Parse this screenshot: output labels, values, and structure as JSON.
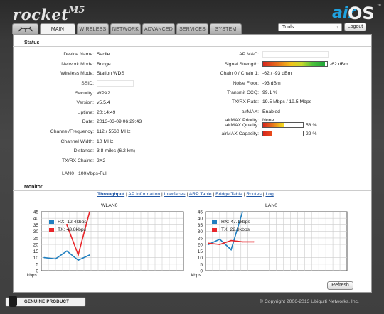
{
  "header": {
    "product": "rocket",
    "model": "M5",
    "brand_air": "air",
    "brand_os": "OS",
    "brand_tm": "™"
  },
  "tabs": [
    {
      "label": "",
      "icon": "ubiquiti-logo-icon"
    },
    {
      "label": "MAIN"
    },
    {
      "label": "WIRELESS"
    },
    {
      "label": "NETWORK"
    },
    {
      "label": "ADVANCED"
    },
    {
      "label": "SERVICES"
    },
    {
      "label": "SYSTEM"
    }
  ],
  "toolbar": {
    "tools_value": "Tools:",
    "tools_arrow": "↕",
    "logout_label": "Logout"
  },
  "status": {
    "title": "Status",
    "left": [
      {
        "k": "Device Name:",
        "v": "Sacile"
      },
      {
        "k": "Network Mode:",
        "v": "Bridge"
      },
      {
        "k": "Wireless Mode:",
        "v": "Station WDS"
      },
      {
        "k": "SSID:",
        "v": ""
      },
      {
        "k": "Security:",
        "v": "WPA2"
      },
      {
        "k": "Version:",
        "v": "v5.5.4"
      },
      {
        "k": "Uptime:",
        "v": "20:14:49"
      },
      {
        "k": "Date:",
        "v": "2013-03-09 06:29:43"
      },
      {
        "k": "Channel/Frequency:",
        "v": "112 / 5560 MHz"
      },
      {
        "k": "Channel Width:",
        "v": "10 MHz"
      },
      {
        "k": "Distance:",
        "v": "3.8 miles (6.2 km)"
      },
      {
        "k": "TX/RX Chains:",
        "v": "2X2"
      }
    ],
    "right": [
      {
        "k": "AP MAC:",
        "v": ""
      },
      {
        "k": "Signal Strength:",
        "v": "-62 dBm"
      },
      {
        "k": "Chain 0 / Chain 1:",
        "v": "-62 / -93 dBm"
      },
      {
        "k": "Noise Floor:",
        "v": "-93 dBm"
      },
      {
        "k": "Transmit CCQ:",
        "v": "99.1 %"
      },
      {
        "k": "TX/RX Rate:",
        "v": "19.5 Mbps / 19.5 Mbps"
      },
      {
        "k": "airMAX:",
        "v": "Enabled"
      },
      {
        "k": "airMAX Priority:",
        "v": "None"
      },
      {
        "k": "airMAX Quality:",
        "v": "53 %"
      },
      {
        "k": "airMAX Capacity:",
        "v": "22 %"
      }
    ],
    "signal_level": 0.97,
    "quality_level": 0.53,
    "capacity_level": 0.22,
    "lan0_label": "LAN0",
    "lan0_value": "100Mbps-Full"
  },
  "monitor": {
    "title": "Monitor",
    "links": [
      "Throughput",
      "AP Information",
      "Interfaces",
      "ARP Table",
      "Bridge Table",
      "Routes",
      "Log"
    ],
    "refresh_label": "Refresh"
  },
  "colors": {
    "rx": "#1f7fc0",
    "tx": "#e8262b",
    "grid": "#cccccc"
  },
  "chart_data": [
    {
      "type": "line",
      "title": "WLAN0",
      "ylabel": "kbps",
      "yticks": [
        "0",
        "5",
        "10",
        "15",
        "20",
        "25",
        "30",
        "35",
        "40",
        "45"
      ],
      "ylim": [
        0,
        45
      ],
      "series": [
        {
          "name": "RX: 12.4kbps",
          "values": [
            10,
            9,
            15,
            8,
            12
          ]
        },
        {
          "name": "TX: 43.8kbps",
          "values": [
            null,
            null,
            35,
            12,
            45
          ]
        }
      ]
    },
    {
      "type": "line",
      "title": "LAN0",
      "ylabel": "kbps",
      "yticks": [
        "0",
        "5",
        "10",
        "15",
        "20",
        "25",
        "30",
        "35",
        "40",
        "45"
      ],
      "ylim": [
        0,
        45
      ],
      "series": [
        {
          "name": "RX: 47.1kbps",
          "values": [
            20,
            24,
            16,
            45
          ]
        },
        {
          "name": "TX: 22.3kbps",
          "values": [
            21,
            20,
            23,
            22,
            22
          ]
        }
      ]
    }
  ],
  "footer": {
    "genuine_label": "GENUINE  PRODUCT",
    "copyright": "© Copyright 2006-2013 Ubiquiti Networks, Inc."
  }
}
